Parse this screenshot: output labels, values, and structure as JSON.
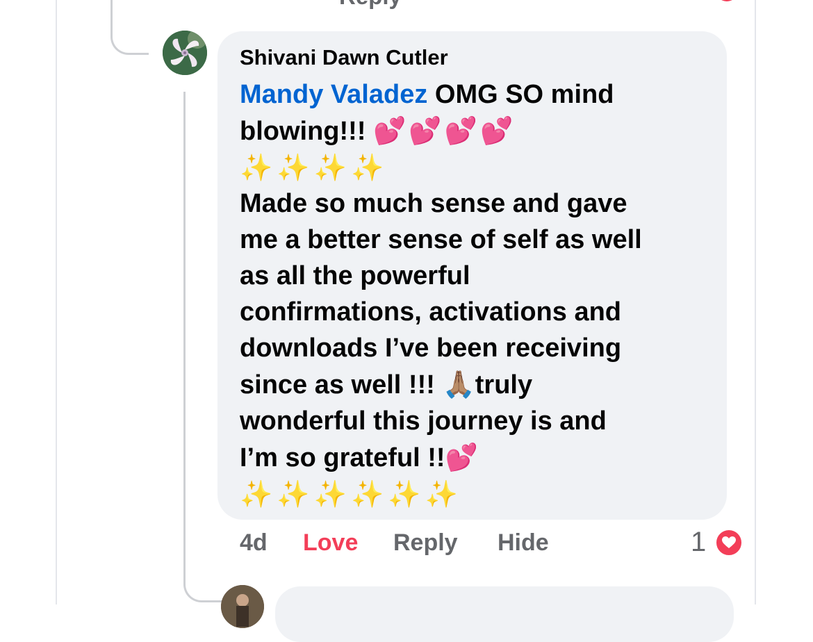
{
  "previous_comment": {
    "reply_label": "Reply"
  },
  "comment": {
    "author": "Shivani Dawn Cutler",
    "mention": "Mandy Valadez",
    "lines": [
      " OMG SO mind",
      "blowing!!! ",
      "Made so much sense and gave",
      "me a better sense of self as well",
      "as  all the powerful",
      "confirmations, activations and",
      "downloads I’ve been receiving",
      "since as well !!! ",
      "truly",
      "wonderful this journey is and",
      "I’m so grateful !!"
    ],
    "emoji": {
      "hearts_4": "💕💕💕💕",
      "sparkles_4": "✨✨✨✨",
      "pray": "🙏🏽",
      "heart_1": "💕",
      "sparkles_6": "✨✨✨✨✨✨"
    },
    "timestamp": "4d",
    "reaction_label": "Love",
    "reply_label": "Reply",
    "hide_label": "Hide",
    "reaction_count": "1"
  },
  "icons": {
    "reaction": "heart-reaction-icon",
    "avatar": "user-avatar"
  },
  "colors": {
    "mention": "#0064d1",
    "love": "#f33e58",
    "bubble": "#f0f2f5",
    "secondary_text": "#65676b"
  }
}
